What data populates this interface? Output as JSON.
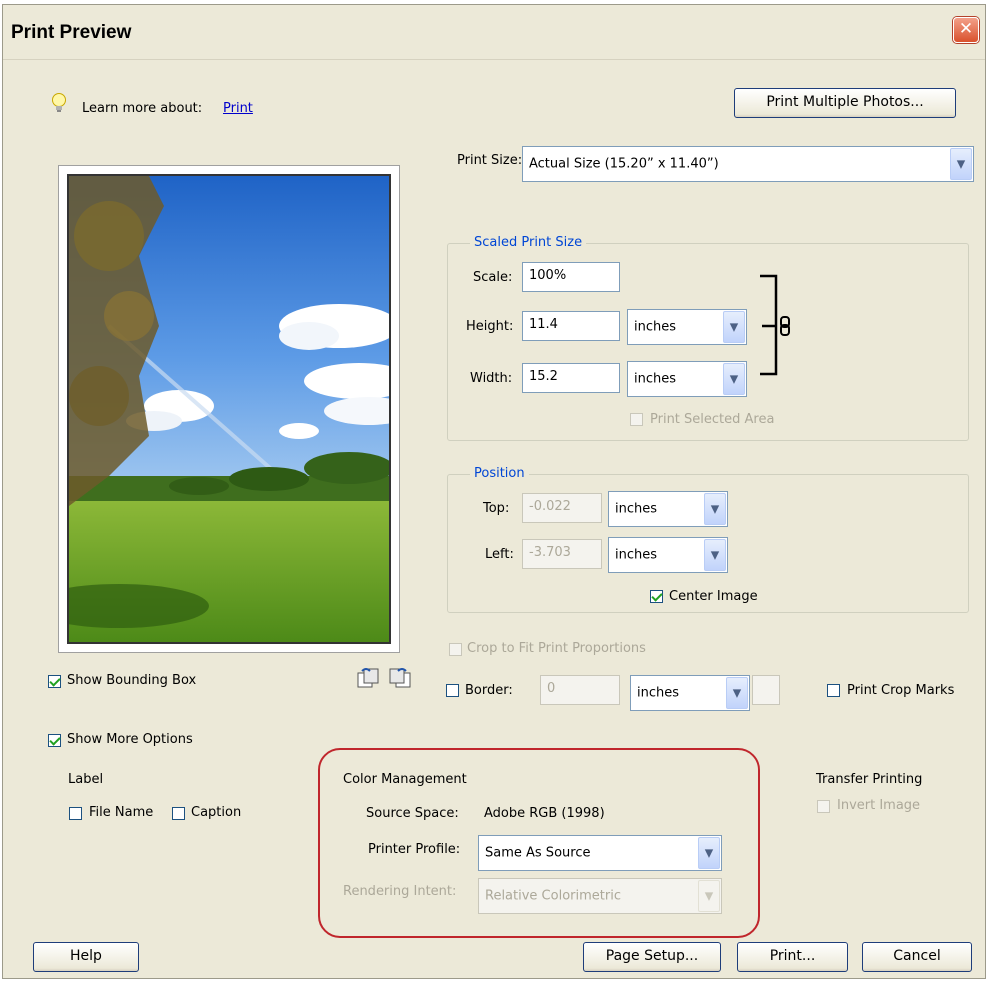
{
  "window": {
    "title": "Print Preview"
  },
  "learn_more": {
    "label": "Learn more about:",
    "link": "Print"
  },
  "buttons": {
    "print_multiple": "Print Multiple Photos...",
    "help": "Help",
    "page_setup": "Page Setup...",
    "print": "Print...",
    "cancel": "Cancel"
  },
  "print_size": {
    "label": "Print Size:",
    "value": "Actual Size (15.20” x 11.40”)"
  },
  "scaled": {
    "legend": "Scaled Print Size",
    "scale_label": "Scale:",
    "scale_value": "100%",
    "height_label": "Height:",
    "height_value": "11.4",
    "height_unit": "inches",
    "width_label": "Width:",
    "width_value": "15.2",
    "width_unit": "inches",
    "print_selected_area": "Print Selected Area"
  },
  "position": {
    "legend": "Position",
    "top_label": "Top:",
    "top_value": "-0.022",
    "top_unit": "inches",
    "left_label": "Left:",
    "left_value": "-3.703",
    "left_unit": "inches",
    "center_image": "Center Image"
  },
  "crop_fit": "Crop to Fit Print Proportions",
  "border": {
    "label": "Border:",
    "value": "0",
    "unit": "inches"
  },
  "print_crop_marks": "Print Crop Marks",
  "show_bounding_box": "Show Bounding Box",
  "show_more_options": "Show More Options",
  "label_section": {
    "heading": "Label",
    "file_name": "File Name",
    "caption": "Caption"
  },
  "color_management": {
    "heading": "Color Management",
    "source_space_label": "Source Space:",
    "source_space_value": "Adobe RGB (1998)",
    "printer_profile_label": "Printer Profile:",
    "printer_profile_value": "Same As Source",
    "rendering_intent_label": "Rendering Intent:",
    "rendering_intent_value": "Relative Colorimetric"
  },
  "transfer_printing": {
    "heading": "Transfer Printing",
    "invert_image": "Invert Image"
  },
  "colors": {
    "accent_circle": "#c0262c",
    "legend_blue": "#0046d5"
  }
}
